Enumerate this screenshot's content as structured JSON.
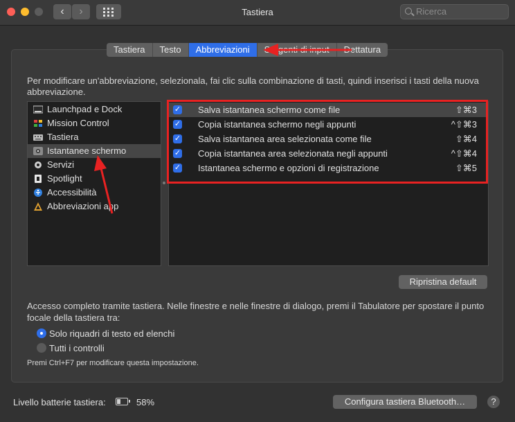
{
  "window": {
    "title": "Tastiera"
  },
  "toolbar": {
    "back": "‹",
    "forward": "›",
    "search_placeholder": "Ricerca"
  },
  "tabs": [
    {
      "label": "Tastiera"
    },
    {
      "label": "Testo"
    },
    {
      "label": "Abbreviazioni"
    },
    {
      "label": "Sorgenti di input"
    },
    {
      "label": "Dettatura"
    }
  ],
  "intro": "Per modificare un'abbreviazione, selezionala, fai clic sulla combinazione di tasti, quindi inserisci i tasti della nuova abbreviazione.",
  "categories": [
    {
      "label": "Launchpad e Dock",
      "icon": "launchpad-icon"
    },
    {
      "label": "Mission Control",
      "icon": "mission-control-icon"
    },
    {
      "label": "Tastiera",
      "icon": "keyboard-icon"
    },
    {
      "label": "Istantanee schermo",
      "icon": "screenshot-icon",
      "selected": true
    },
    {
      "label": "Servizi",
      "icon": "gear-icon"
    },
    {
      "label": "Spotlight",
      "icon": "spotlight-icon"
    },
    {
      "label": "Accessibilità",
      "icon": "accessibility-icon"
    },
    {
      "label": "Abbreviazioni app",
      "icon": "app-shortcuts-icon"
    }
  ],
  "shortcuts": [
    {
      "checked": true,
      "label": "Salva istantanea schermo come file",
      "shortcut": "⇧⌘3"
    },
    {
      "checked": true,
      "label": "Copia istantanea schermo negli appunti",
      "shortcut": "^⇧⌘3"
    },
    {
      "checked": true,
      "label": "Salva istantanea area selezionata come file",
      "shortcut": "⇧⌘4"
    },
    {
      "checked": true,
      "label": "Copia istantanea area selezionata negli appunti",
      "shortcut": "^⇧⌘4"
    },
    {
      "checked": true,
      "label": "Istantanea schermo e opzioni di registrazione",
      "shortcut": "⇧⌘5"
    }
  ],
  "restore_default": "Ripristina default",
  "access": {
    "text": "Accesso completo tramite tastiera. Nelle finestre e nelle finestre di dialogo, premi il Tabulatore per spostare il punto focale della tastiera tra:",
    "options": [
      {
        "label": "Solo riquadri di testo ed elenchi",
        "selected": true
      },
      {
        "label": "Tutti i controlli",
        "selected": false
      }
    ],
    "note": "Premi Ctrl+F7 per modificare questa impostazione."
  },
  "battery": {
    "label": "Livello batterie tastiera:",
    "percent": "58%"
  },
  "bluetooth_button": "Configura tastiera Bluetooth…",
  "help": "?",
  "colors": {
    "accent": "#2f6ee8",
    "annotation": "#e82222"
  }
}
